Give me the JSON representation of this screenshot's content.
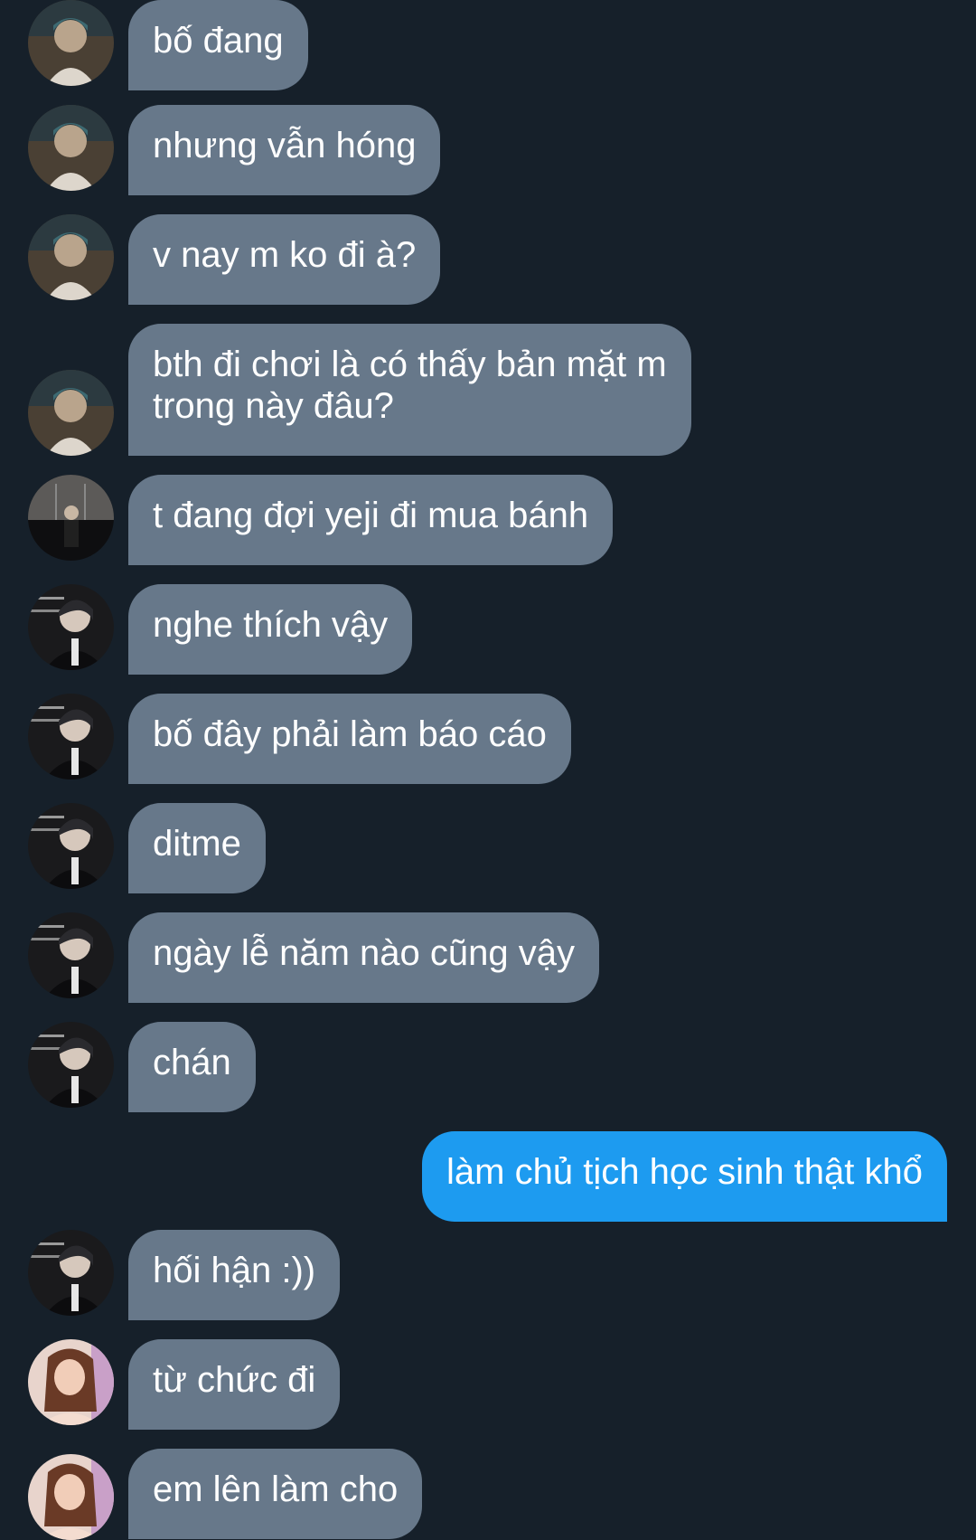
{
  "theme": {
    "background": "#16202a",
    "incoming_bubble": "#67788a",
    "outgoing_bubble": "#1d9bf0",
    "text": "#ffffff"
  },
  "messages": [
    {
      "sender": "user-a",
      "text": "bố đang"
    },
    {
      "sender": "user-a",
      "text": "nhưng vẫn hóng"
    },
    {
      "sender": "user-a",
      "text": "v nay m ko đi à?"
    },
    {
      "sender": "user-a",
      "text": "bth đi chơi là có thấy bản mặt m\ntrong này đâu?"
    },
    {
      "sender": "user-b",
      "text": "t đang đợi yeji đi mua bánh"
    },
    {
      "sender": "user-c",
      "text": "nghe thích vậy"
    },
    {
      "sender": "user-c",
      "text": "bố đây phải làm báo cáo"
    },
    {
      "sender": "user-c",
      "text": "ditme"
    },
    {
      "sender": "user-c",
      "text": "ngày lễ năm nào cũng vậy"
    },
    {
      "sender": "user-c",
      "text": "chán"
    },
    {
      "sender": "me",
      "text": "làm chủ tịch học sinh thật khổ"
    },
    {
      "sender": "user-c",
      "text": "hối hận :))"
    },
    {
      "sender": "user-d",
      "text": "từ chức đi"
    },
    {
      "sender": "user-d",
      "text": "em lên làm cho"
    }
  ]
}
